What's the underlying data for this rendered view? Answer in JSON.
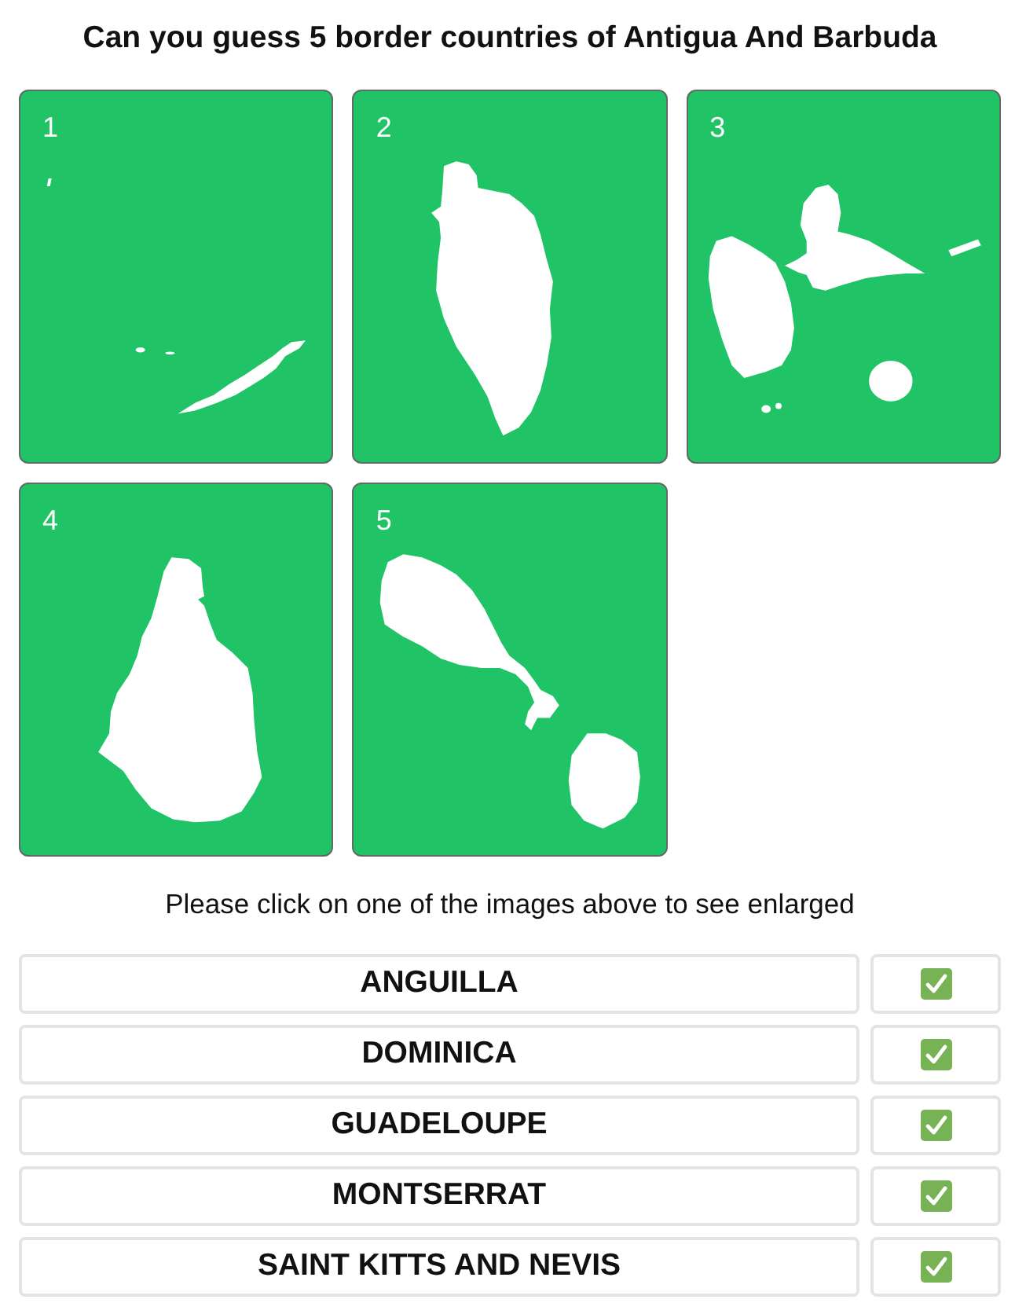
{
  "title": "Can you guess 5 border countries of Antigua And Barbuda",
  "maps": [
    {
      "number": "1",
      "kind": "anguilla"
    },
    {
      "number": "2",
      "kind": "dominica"
    },
    {
      "number": "3",
      "kind": "guadeloupe"
    },
    {
      "number": "4",
      "kind": "montserrat"
    },
    {
      "number": "5",
      "kind": "saint-kitts-nevis"
    }
  ],
  "hint": "Please click on one of the images above to see enlarged",
  "answers": [
    {
      "name": "ANGUILLA",
      "correct": true
    },
    {
      "name": "DOMINICA",
      "correct": true
    },
    {
      "name": "GUADELOUPE",
      "correct": true
    },
    {
      "name": "MONTSERRAT",
      "correct": true
    },
    {
      "name": "SAINT KITTS AND NEVIS",
      "correct": true
    }
  ]
}
